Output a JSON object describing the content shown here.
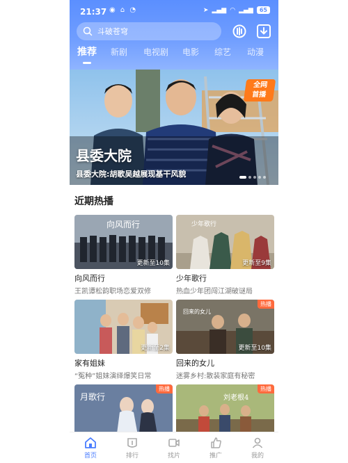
{
  "status": {
    "time": "21:37",
    "battery": "65"
  },
  "search": {
    "placeholder": "斗破苍穹"
  },
  "tabs": [
    "推荐",
    "新剧",
    "电视剧",
    "电影",
    "综艺",
    "动漫"
  ],
  "banner": {
    "title": "县委大院",
    "subtitle": "县委大院:胡歌吴越展现基干风貌",
    "badge_line1": "全网",
    "badge_line2": "首播",
    "slide_index": 1,
    "slide_count": 5
  },
  "section": {
    "title": "近期热播"
  },
  "cards": [
    {
      "name": "向风而行",
      "desc": "王凯谭松韵职场恋爱双修",
      "episode": "更新至10集",
      "tag": "",
      "thumb_text": "向风而行"
    },
    {
      "name": "少年歌行",
      "desc": "热血少年团闯江湖破谜局",
      "episode": "更新至9集",
      "tag": "",
      "thumb_text": "少年歌行"
    },
    {
      "name": "家有姐妹",
      "desc": "“冤种”姐妹演绎爆笑日常",
      "episode": "更新至2集",
      "tag": "",
      "thumb_text": ""
    },
    {
      "name": "回来的女儿",
      "desc": "迷雾乡村:散装家庭有秘密",
      "episode": "更新至10集",
      "tag": "热播",
      "thumb_text": "回来的女儿"
    },
    {
      "name": "",
      "desc": "",
      "episode": "",
      "tag": "热播",
      "thumb_text": "月歌行"
    },
    {
      "name": "",
      "desc": "",
      "episode": "",
      "tag": "热播",
      "thumb_text": "刘老根4"
    }
  ],
  "nav": [
    "首页",
    "排行",
    "找片",
    "推广",
    "我的"
  ],
  "colors": {
    "accent": "#4a7dff",
    "header": "#6f9dff",
    "tag": "#ff6a3d"
  }
}
